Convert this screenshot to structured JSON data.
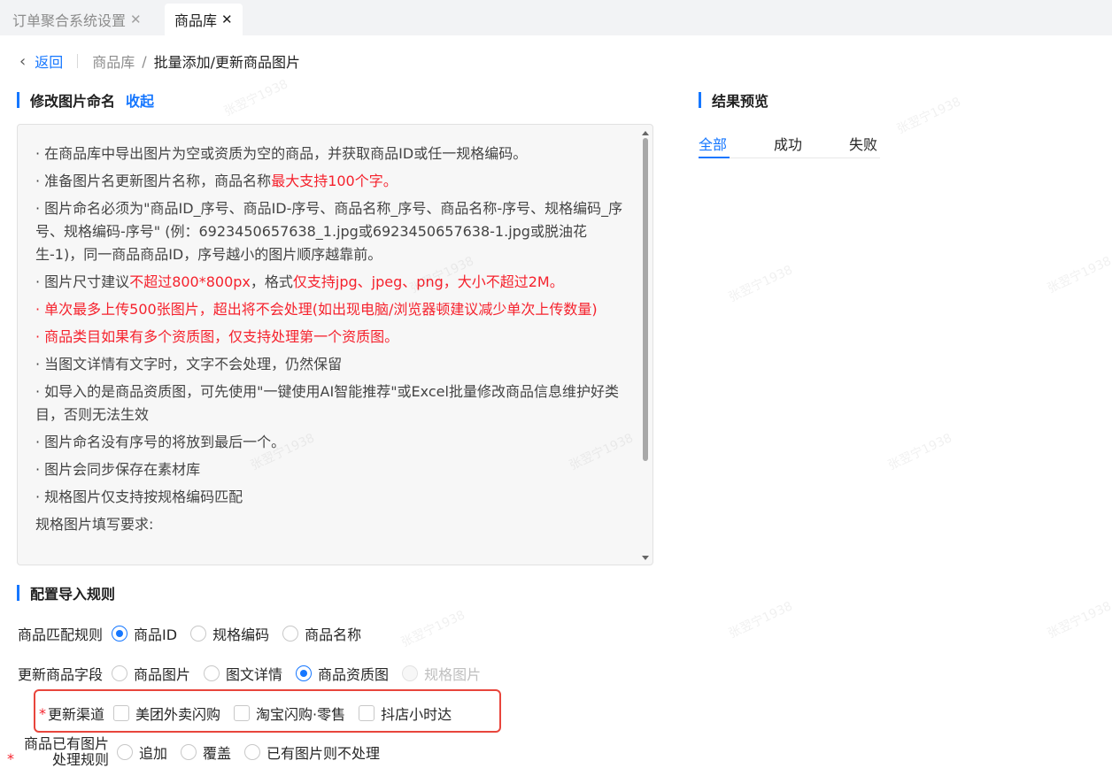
{
  "tabs": [
    {
      "label": "订单聚合系统设置",
      "active": false
    },
    {
      "label": "商品库",
      "active": true
    }
  ],
  "breadcrumb": {
    "back_label": "返回",
    "parent": "商品库",
    "separator": "/",
    "current": "批量添加/更新商品图片"
  },
  "rename_section": {
    "title": "修改图片命名",
    "collapse_label": "收起",
    "notes": {
      "n1": "· 在商品库中导出图片为空或资质为空的商品，并获取商品ID或任一规格编码。",
      "n2a": "· 准备图片名更新图片名称，商品名称",
      "n2b": "最大支持100个字。",
      "n3": "· 图片命名必须为\"商品ID_序号、商品ID-序号、商品名称_序号、商品名称-序号、规格编码_序号、规格编码-序号\" (例：6923450657638_1.jpg或6923450657638-1.jpg或脱油花生-1)，同一商品商品ID，序号越小的图片顺序越靠前。",
      "n4a": "· 图片尺寸建议",
      "n4b": "不超过800*800px",
      "n4c": "，格式",
      "n4d": "仅支持jpg、jpeg、png，大小不超过2M。",
      "n5": "· 单次最多上传500张图片，超出将不会处理(如出现电脑/浏览器顿建议减少单次上传数量)",
      "n6": "· 商品类目如果有多个资质图，仅支持处理第一个资质图。",
      "n7": "· 当图文详情有文字时，文字不会处理，仍然保留",
      "n8": "· 如导入的是商品资质图，可先使用\"一键使用AI智能推荐\"或Excel批量修改商品信息维护好类目，否则无法生效",
      "n9": "· 图片命名没有序号的将放到最后一个。",
      "n10": "· 图片会同步保存在素材库",
      "n11": "· 规格图片仅支持按规格编码匹配",
      "n12": "规格图片填写要求:"
    }
  },
  "result_section": {
    "title": "结果预览",
    "tabs": [
      "全部",
      "成功",
      "失败"
    ],
    "active_tab": "全部"
  },
  "rules_section": {
    "title": "配置导入规则",
    "match_rule": {
      "label": "商品匹配规则",
      "options": [
        "商品ID",
        "规格编码",
        "商品名称"
      ],
      "selected": "商品ID"
    },
    "update_field": {
      "label": "更新商品字段",
      "options": [
        "商品图片",
        "图文详情",
        "商品资质图",
        "规格图片"
      ],
      "selected": "商品资质图",
      "disabled": "规格图片"
    },
    "channel": {
      "required_mark": "*",
      "label": "更新渠道",
      "options": [
        "美团外卖闪购",
        "淘宝闪购·零售",
        "抖店小时达"
      ]
    },
    "existing_rule": {
      "required_mark": "*",
      "label_line1": "商品已有图片",
      "label_line2": "处理规则",
      "options": [
        "追加",
        "覆盖",
        "已有图片则不处理"
      ]
    }
  },
  "watermark_text": "张翌宁1938",
  "colors": {
    "primary": "#1677ff",
    "danger": "#f5222d",
    "highlight_border": "#e8453c"
  }
}
